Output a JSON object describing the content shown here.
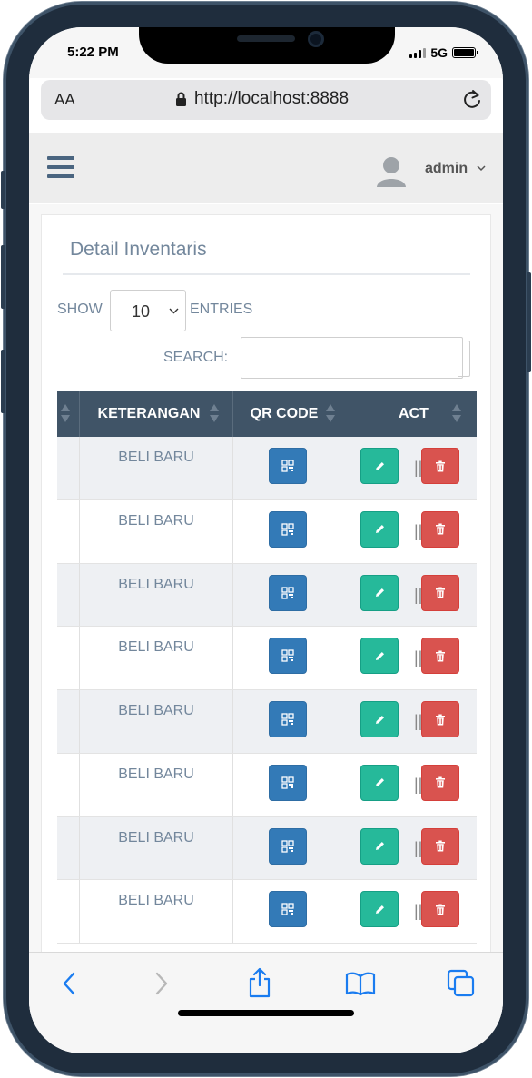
{
  "status_bar": {
    "time": "5:22 PM",
    "network": "5G"
  },
  "browser": {
    "text_size_label": "AA",
    "url": "http://localhost:8888"
  },
  "header": {
    "user_name": "admin"
  },
  "card": {
    "title": "Detail Inventaris"
  },
  "table_controls": {
    "show_label": "SHOW",
    "entries_value": "10",
    "entries_label": "ENTRIES",
    "search_label": "SEARCH:",
    "search_value": ""
  },
  "table": {
    "columns": [
      "KETERANGAN",
      "QR CODE",
      "ACT"
    ],
    "rows": [
      {
        "keterangan": "BELI BARU"
      },
      {
        "keterangan": "BELI BARU"
      },
      {
        "keterangan": "BELI BARU"
      },
      {
        "keterangan": "BELI BARU"
      },
      {
        "keterangan": "BELI BARU"
      },
      {
        "keterangan": "BELI BARU"
      },
      {
        "keterangan": "BELI BARU"
      },
      {
        "keterangan": "BELI BARU"
      }
    ],
    "separator": "||"
  },
  "colors": {
    "table_header": "#405467",
    "qr_button": "#337ab7",
    "edit_button": "#26b99a",
    "delete_button": "#d9534f"
  },
  "icons": {
    "qr": "qr-code-icon",
    "edit": "pencil-icon",
    "delete": "trash-icon"
  }
}
